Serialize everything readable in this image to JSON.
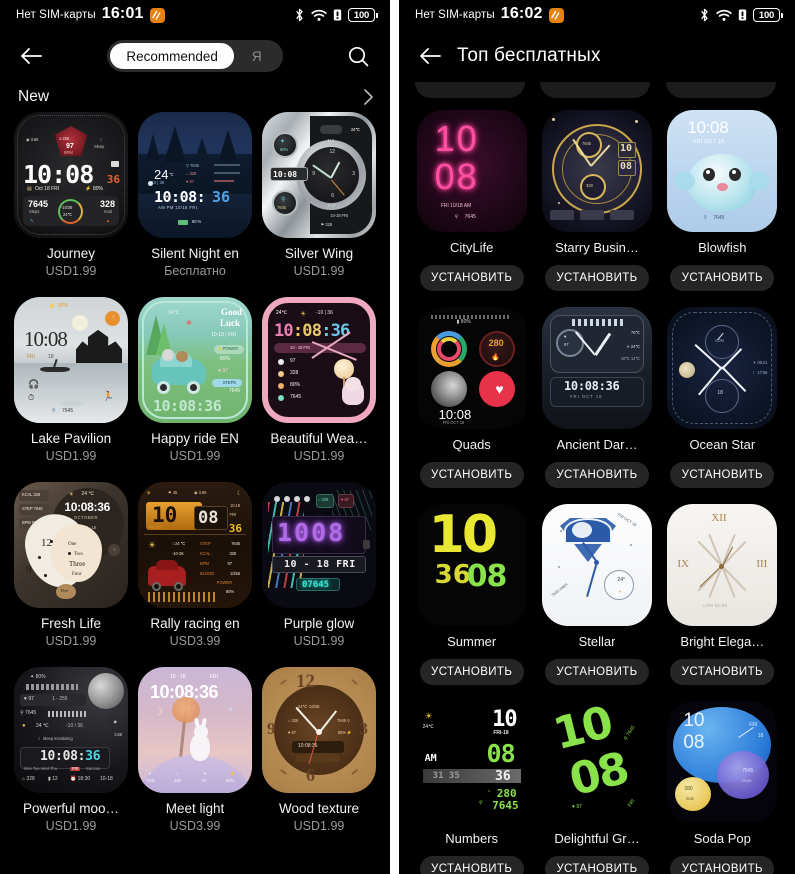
{
  "left_phone": {
    "status_bar": {
      "sim_text": "Нет SIM-карты",
      "time": "16:01",
      "badge_icon": "screen-record-icon",
      "bluetooth_icon": "bluetooth-icon",
      "wifi_icon": "wifi-icon",
      "alert_icon": "battery-alert-icon",
      "battery_level": "100"
    },
    "header": {
      "back_icon": "back-arrow-icon",
      "search_icon": "search-icon",
      "segments": [
        {
          "label": "Recommended",
          "active": true
        },
        {
          "label": "Я",
          "active": false
        }
      ]
    },
    "section": {
      "title": "New",
      "chevron_icon": "chevron-right-icon"
    },
    "cards": [
      {
        "name": "Journey",
        "price": "USD1.99",
        "art": "journey"
      },
      {
        "name": "Silent Night en",
        "price": "Бесплатно",
        "art": "silent-night"
      },
      {
        "name": "Silver Wing",
        "price": "USD1.99",
        "art": "silver-wing"
      },
      {
        "name": "Lake Pavilion",
        "price": "USD1.99",
        "art": "lake-pavilion"
      },
      {
        "name": "Happy ride EN",
        "price": "USD1.99",
        "art": "happy-ride"
      },
      {
        "name": "Beautiful Wea…",
        "price": "USD1.99",
        "art": "beautiful-weather"
      },
      {
        "name": "Fresh Life",
        "price": "USD1.99",
        "art": "fresh-life"
      },
      {
        "name": "Rally racing en",
        "price": "USD3.99",
        "art": "rally-racing"
      },
      {
        "name": "Purple glow",
        "price": "USD1.99",
        "art": "purple-glow"
      },
      {
        "name": "Powerful moo…",
        "price": "USD1.99",
        "art": "powerful-moon"
      },
      {
        "name": "Meet light",
        "price": "USD3.99",
        "art": "meet-light"
      },
      {
        "name": "Wood texture",
        "price": "USD1.99",
        "art": "wood-texture"
      }
    ]
  },
  "right_phone": {
    "status_bar": {
      "sim_text": "Нет SIM-карты",
      "time": "16:02",
      "badge_icon": "screen-record-icon",
      "bluetooth_icon": "bluetooth-icon",
      "wifi_icon": "wifi-icon",
      "alert_icon": "battery-alert-icon",
      "battery_level": "100"
    },
    "header": {
      "back_icon": "back-arrow-icon",
      "title": "Топ бесплатных"
    },
    "install_label": "УСТАНОВИТЬ",
    "cards": [
      {
        "name": "CityLife",
        "art": "citylife"
      },
      {
        "name": "Starry Busin…",
        "art": "starry-business"
      },
      {
        "name": "Blowfish",
        "art": "blowfish"
      },
      {
        "name": "Quads",
        "art": "quads"
      },
      {
        "name": "Ancient Dar…",
        "art": "ancient-dark"
      },
      {
        "name": "Ocean Star",
        "art": "ocean-star"
      },
      {
        "name": "Summer",
        "art": "summer"
      },
      {
        "name": "Stellar",
        "art": "stellar"
      },
      {
        "name": "Bright Elega…",
        "art": "bright-elegance"
      },
      {
        "name": "Numbers",
        "art": "numbers"
      },
      {
        "name": "Delightful Gr…",
        "art": "delightful-green"
      },
      {
        "name": "Soda Pop",
        "art": "soda-pop"
      }
    ]
  },
  "watch_face_text": {
    "journey": {
      "time": "10:08",
      "sec": "36",
      "date": "Oct 18  FRI",
      "batt": "80%",
      "steps": "7645",
      "steps_lbl": "Steps",
      "kcal": "328",
      "kcal_lbl": "Kcal",
      "hr": "97",
      "hr_range": "1-255",
      "bpm": "BPM",
      "dist": "3.66",
      "sleep": "Sleep",
      "temp": "-10/36",
      "temp2": "24℃"
    },
    "silent_night": {
      "temp": "24",
      "unit": "℃",
      "time": "10:08:",
      "sec": "36",
      "ampm": "AM PM  10/18  FRI.",
      "steps": "7645",
      "kcal": "328",
      "hr": "97",
      "batt": "80 %",
      "rng": "-10 | 36"
    },
    "silver_wing": {
      "time": "10:08",
      "temp": "24℃",
      "steps": "7645",
      "batt": "80%",
      "hr": "97",
      "date": "10-18 FRI",
      "kcal": "328"
    },
    "lake_pavilion": {
      "time": "10:08",
      "date": "FRI   18",
      "batt": "80%",
      "steps": "7645"
    },
    "happy_ride": {
      "temp": "24℃",
      "title": "Good Luck",
      "date": "10-18 | FRI",
      "batt": "80%",
      "hr": "97",
      "steps": "7645",
      "time": "10:08:36"
    },
    "beautiful": {
      "temp": "24℃",
      "rng": "-10 | 36",
      "time": "10:08:36",
      "date": "10 - 18        FRI",
      "hr": "97",
      "kcal": "328",
      "batt": "80%",
      "steps": "7645"
    },
    "fresh_life": {
      "kcal": "KCAL 328",
      "step": "STEP 7645",
      "bpm": "BPM 97",
      "temp": "24 ℃",
      "time": "10:08:36",
      "month": "OCTOBER",
      "date": "10 - 18",
      "day": "FRI",
      "n12": "12",
      "n9": "9",
      "n6": "6",
      "w1": "One",
      "w2": "Two",
      "w3": "Three",
      "w4": "Four",
      "w5": "Five"
    },
    "rally": {
      "h": "10",
      "m": "08",
      "s": "36",
      "date": "10.18",
      "day": "FRI",
      "steps": "45",
      "dist": "3.66",
      "temp": "24 ℃",
      "rng": "-10-36",
      "v1": "7645",
      "v2": "328",
      "v3": "97",
      "v4": "1/256",
      "power": "POWER",
      "batt": "80%"
    },
    "purple_glow": {
      "digits": "1008",
      "date": "10 - 18   FRI",
      "steps": "07645",
      "hr": "97",
      "kcal": "328"
    },
    "powerful_moon": {
      "batt": "80%",
      "hr": "97",
      "rng": "1 - 255",
      "steps": "7645",
      "temp": "24 ℃",
      "trng": "-10 / 36",
      "sleep": "Sleep monitoring",
      "time": "10:08:36",
      "days": "Mon Tue Wed Thu FRI Sat Sun",
      "kcal": "328",
      "n12": "12",
      "t2": "18:30",
      "date": "10-18",
      "dist": "3.66"
    },
    "meet_light": {
      "date": "10 - 18",
      "day": "FRI",
      "time": "10:08:36",
      "steps": "7645",
      "kcal": "328",
      "hr": "97",
      "batt": "80%"
    },
    "wood": {
      "n12": "12",
      "n3": "3",
      "n6": "6",
      "n9": "9",
      "temp": "24℃  -10/36",
      "kcal": "328",
      "steps": "7645",
      "hr": "97",
      "batt": "80%",
      "time": "10:08:36"
    },
    "citylife": {
      "h": "10",
      "m": "08",
      "date": "FRI 10/18 AM",
      "steps": "7645"
    },
    "starry": {
      "h": "10",
      "m": "08",
      "brand": "7645"
    },
    "blowfish": {
      "time": "10:08",
      "date": "FRI OCT 18",
      "steps": "7645"
    },
    "quads": {
      "batt": "80%",
      "kcal": "280",
      "time": "10:08",
      "date": "FRI OCT 18"
    },
    "ancient": {
      "time": "10:08:36",
      "date": "FRI OCT 18",
      "temp": "24℃",
      "rng": "18℃  14℃"
    },
    "ocean": {
      "lon": "LON",
      "sr": "06:21",
      "ss": "17:56",
      "date": "18"
    },
    "summer": {
      "h": "10",
      "m": "08",
      "s": "36"
    },
    "stellar": {
      "date": "FRI OCT 18",
      "temp": "24°",
      "brand": "7645 steps"
    },
    "bright": {
      "n12": "XII",
      "n3": "III",
      "n9": "IX",
      "lon": "LON 02:08"
    },
    "numbers": {
      "temp": "24℃",
      "h": "10",
      "date": "FRI-18",
      "m": "08",
      "ampm": "AM",
      "s": "36",
      "mid": "31 35",
      "kcal": "280",
      "steps": "7645"
    },
    "delightful": {
      "h": "10",
      "m": "08",
      "hr": "97",
      "day": "FRI"
    },
    "soda": {
      "h": "10",
      "m": "08",
      "date": "FRI 18",
      "steps": "7645",
      "steps_lbl": "Steps",
      "kcal": "280",
      "kcal_lbl": "kcal"
    }
  },
  "colors": {
    "background": "#000000",
    "separator": "#ffffff",
    "text_primary": "#f3f3f3",
    "text_secondary": "#9a9a9a",
    "segment_bg": "#2b2b2b",
    "segment_active_bg": "#ffffff",
    "install_bg": "#252525",
    "badge_orange": "#e8810f"
  }
}
